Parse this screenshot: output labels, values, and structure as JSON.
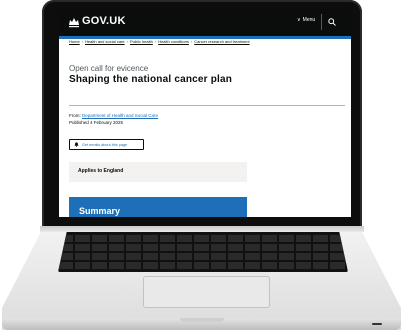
{
  "header": {
    "logo_text": "GOV.UK",
    "menu_label": "Menu"
  },
  "breadcrumbs": [
    "Home",
    "Health and social care",
    "Public health",
    "Health conditions",
    "Cancer research and treatment"
  ],
  "page": {
    "caption": "Open call for evicence",
    "title": "Shaping the national cancer plan",
    "from_label": "From:",
    "from_link": "Department of Health and Social Care",
    "published": "Published 4 February 2025"
  },
  "alert_button_label": "Get emails about this page",
  "applies_to": "Applies to England",
  "summary_heading": "Summary",
  "colors": {
    "header_bg": "#0b0c0c",
    "brand_blue": "#1d70b8",
    "panel_grey": "#f3f2f1"
  },
  "icons": [
    "crown-icon",
    "chevron-down-icon",
    "search-icon",
    "bell-icon"
  ]
}
